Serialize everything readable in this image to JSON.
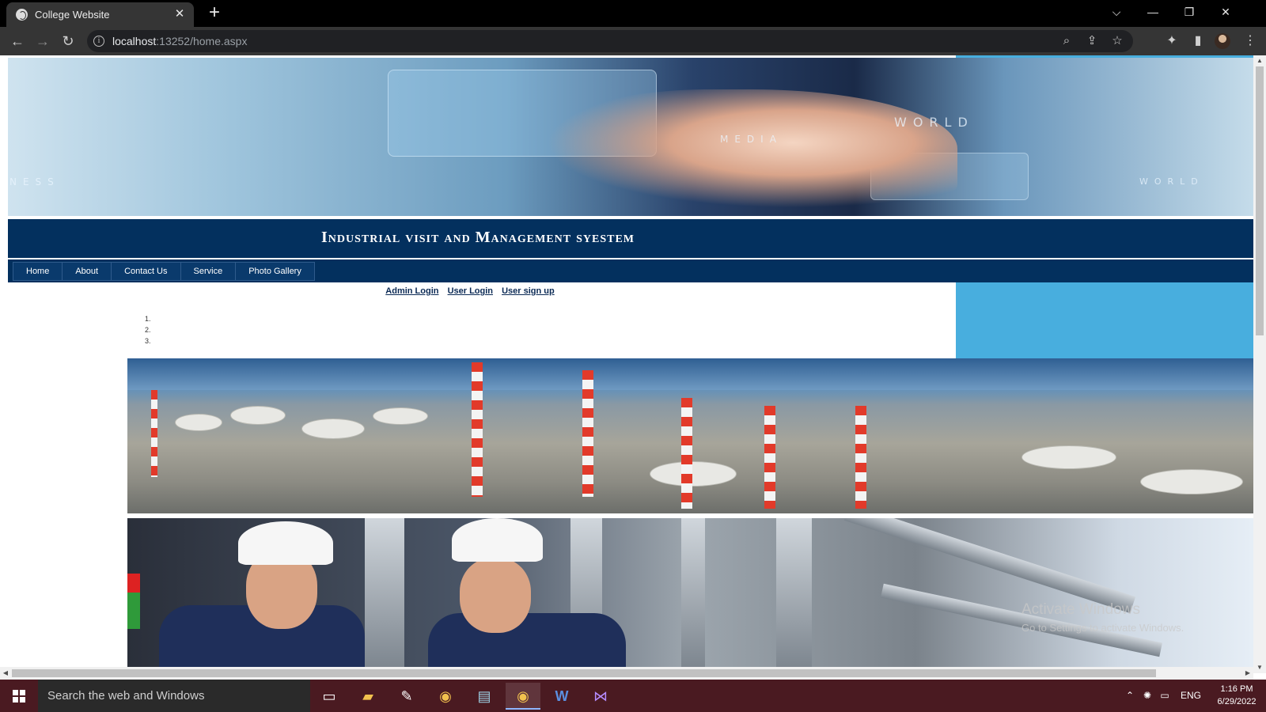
{
  "browser": {
    "tab_title": "College Website",
    "url_host": "localhost",
    "url_rest": ":13252/home.aspx",
    "icons": [
      "globe-icon",
      "close-icon",
      "plus-icon",
      "chevron-down-icon",
      "minimize-icon",
      "restore-icon",
      "window-close-icon",
      "back-icon",
      "forward-icon",
      "reload-icon",
      "info-icon",
      "zoom-icon",
      "share-icon",
      "star-icon",
      "extensions-icon",
      "sidepanel-icon",
      "profile-avatar",
      "menu-dots-icon"
    ]
  },
  "site": {
    "title": "Industrial visit and Management syestem",
    "menu": [
      "Home",
      "About",
      "Contact Us",
      "Service",
      "Photo Gallery"
    ],
    "auth_links": [
      "Admin Login",
      "User Login",
      "User sign up"
    ],
    "list_numbers": [
      "1.",
      "2.",
      "3."
    ],
    "banner_words": [
      "WORLD",
      "MEDIA",
      "WORLD",
      "NESS"
    ],
    "colors": {
      "header_navy": "#03305e",
      "sidebar_blue": "#48aede",
      "link_navy": "#0b2a55"
    }
  },
  "watermark": {
    "line1": "Activate Windows",
    "line2": "Go to Settings to activate Windows."
  },
  "taskbar": {
    "search_placeholder": "Search the web and Windows",
    "language": "ENG",
    "time": "1:16 PM",
    "date": "6/29/2022",
    "apps": [
      "task-view-icon",
      "file-explorer-icon",
      "paint-icon",
      "chrome-icon",
      "notepad-icon",
      "chrome-active-icon",
      "word-icon",
      "visual-studio-icon"
    ]
  }
}
